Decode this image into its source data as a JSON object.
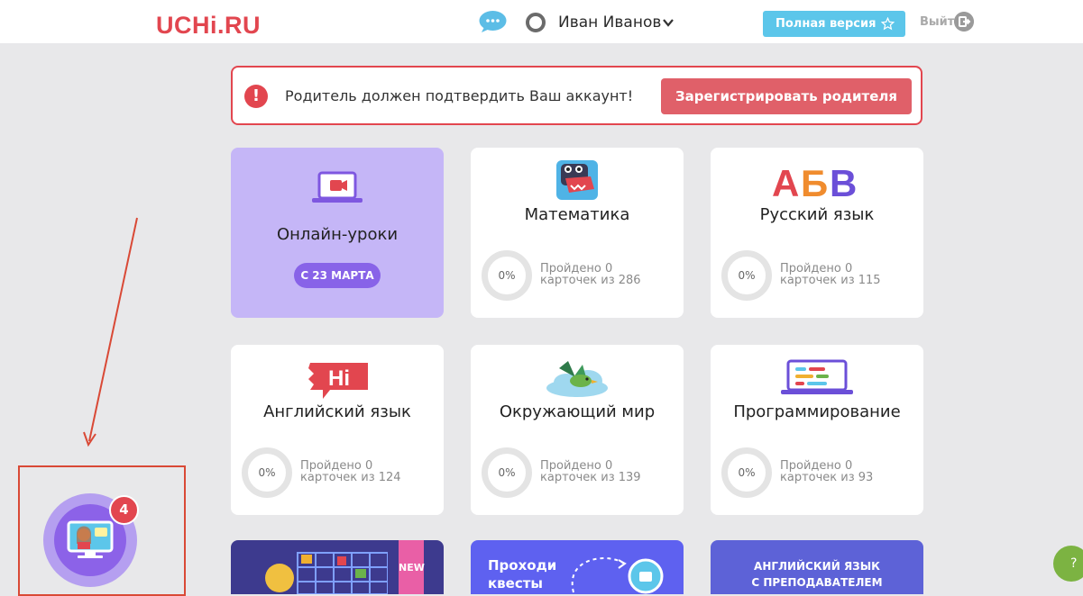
{
  "header": {
    "logo": "UCHi.RU",
    "user_name": "Иван Иванов",
    "full_version_label": "Полная версия",
    "logout_label": "Выйти"
  },
  "alert": {
    "icon_text": "!",
    "message": "Родитель должен подтвердить Ваш аккаунт!",
    "register_label": "Зарегистрировать родителя"
  },
  "cards": [
    {
      "title": "Онлайн-уроки",
      "badge": "С 23 МАРТА",
      "icon": "video-laptop-icon"
    },
    {
      "title": "Математика",
      "percent": "0%",
      "line1": "Пройдено 0",
      "line2": "карточек из 286",
      "icon": "dino-icon"
    },
    {
      "title": "Русский язык",
      "percent": "0%",
      "line1": "Пройдено 0",
      "line2": "карточек из 115",
      "icon": "abv-letters-icon"
    },
    {
      "title": "Английский язык",
      "percent": "0%",
      "line1": "Пройдено 0",
      "line2": "карточек из 124",
      "icon": "hi-speech-icon"
    },
    {
      "title": "Окружающий мир",
      "percent": "0%",
      "line1": "Пройдено 0",
      "line2": "карточек из 139",
      "icon": "bird-cloud-icon"
    },
    {
      "title": "Программирование",
      "percent": "0%",
      "line1": "Пройдено 0",
      "line2": "карточек из 93",
      "icon": "code-laptop-icon"
    }
  ],
  "bottom_tiles": {
    "new_label": "NEW",
    "quests_line1": "Проходи",
    "quests_line2": "квесты",
    "english_line1": "АНГЛИЙСКИЙ ЯЗЫК",
    "english_line2": "С ПРЕПОДАВАТЕЛЕМ"
  },
  "lessons_widget": {
    "badge_count": "4"
  },
  "help": {
    "label": "?"
  },
  "colors": {
    "brand": "#e2464f",
    "full_version_bg": "#5cc6ea",
    "online_card_bg": "#c5b6f7",
    "date_badge": "#8863e8",
    "register_button": "#e06069"
  }
}
